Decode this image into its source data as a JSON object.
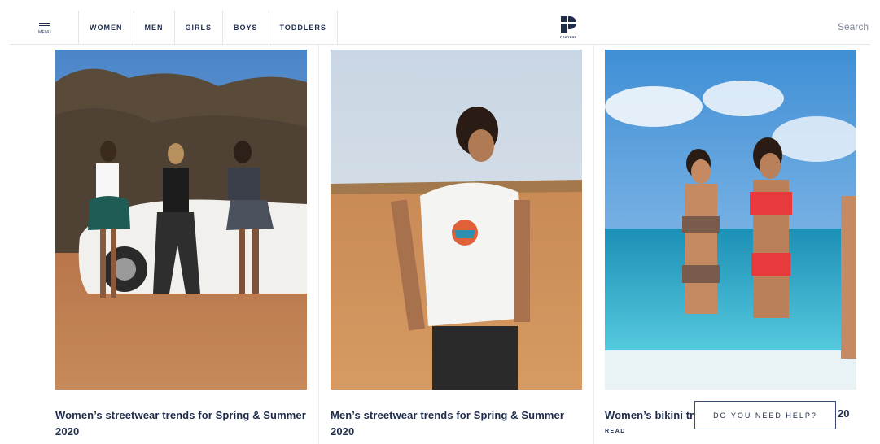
{
  "header": {
    "menu_label": "MENU",
    "categories": [
      "WOMEN",
      "MEN",
      "GIRLS",
      "BOYS",
      "TODDLERS"
    ],
    "logo_text": "PROTEST",
    "search_label": "Search"
  },
  "articles": [
    {
      "title": "Women’s streetwear trends for Spring & Summer 2020",
      "image": "three women posing by a white vintage car in a desert"
    },
    {
      "title": "Men’s streetwear trends for Spring & Summer 2020",
      "image": "man in white t-shirt on a sandy desert road"
    },
    {
      "title": "Women’s bikini tr",
      "title_tail": "20",
      "read_label": "READ",
      "image": "women in bikinis running on a beach"
    }
  ],
  "help_button": "DO YOU NEED HELP?",
  "colors": {
    "navy": "#1f2d4d",
    "divider": "#e6e6e6"
  }
}
